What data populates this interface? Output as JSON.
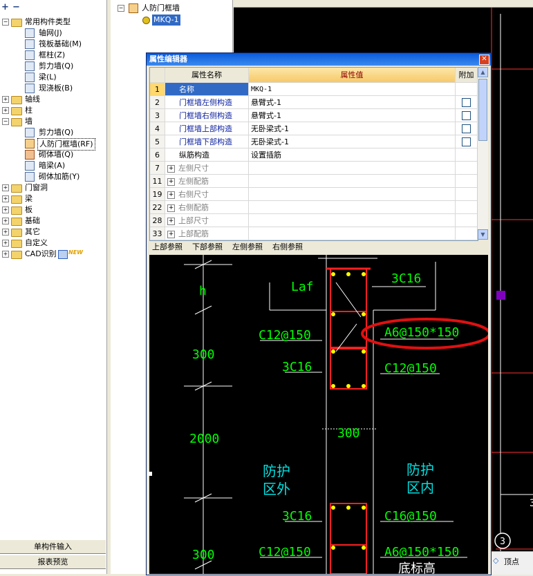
{
  "left_tree": {
    "root": "常用构件类型",
    "root_children": [
      "轴网(J)",
      "筏板基础(M)",
      "框柱(Z)",
      "剪力墙(Q)",
      "梁(L)",
      "现浇板(B)"
    ],
    "group_axis": "轴线",
    "group_col": "柱",
    "group_wall": "墙",
    "wall_children": [
      "剪力墙(Q)",
      "人防门框墙(RF)",
      "砌体墙(Q)",
      "暗梁(A)",
      "砌体加筋(Y)"
    ],
    "groups_after": [
      "门窗洞",
      "梁",
      "板",
      "基础",
      "其它",
      "自定义",
      "CAD识别"
    ],
    "new_badge": "NEW",
    "bottom_buttons": [
      "单构件输入",
      "报表预览"
    ]
  },
  "mid_tree": {
    "parent": "人防门框墙",
    "child": "MKQ-1"
  },
  "dialog": {
    "title": "属性编辑器",
    "close_glyph": "✕",
    "headers": {
      "name": "属性名称",
      "value": "属性值",
      "extra": "附加"
    },
    "rows": [
      {
        "num": "1",
        "name": "名称",
        "value": "MKQ-1"
      },
      {
        "num": "2",
        "name": "门框墙左侧构造",
        "value": "悬臂式-1"
      },
      {
        "num": "3",
        "name": "门框墙右侧构造",
        "value": "悬臂式-1"
      },
      {
        "num": "4",
        "name": "门框墙上部构造",
        "value": "无卧梁式-1"
      },
      {
        "num": "5",
        "name": "门框墙下部构造",
        "value": "无卧梁式-1"
      },
      {
        "num": "6",
        "name": "纵筋构造",
        "value": "设置插筋"
      },
      {
        "num": "7",
        "name": "左侧尺寸",
        "value": ""
      },
      {
        "num": "11",
        "name": "左侧配筋",
        "value": ""
      },
      {
        "num": "19",
        "name": "右侧尺寸",
        "value": ""
      },
      {
        "num": "22",
        "name": "右侧配筋",
        "value": ""
      },
      {
        "num": "28",
        "name": "上部尺寸",
        "value": ""
      },
      {
        "num": "33",
        "name": "上部配筋",
        "value": ""
      }
    ],
    "tabs": [
      "上部参照",
      "下部参照",
      "左侧参照",
      "右侧参照"
    ]
  },
  "drawing": {
    "labels": {
      "h": "h",
      "laf": "Laf",
      "top_bars": "3C16",
      "c12_1": "C12@150",
      "a6_1": "A6@150*150",
      "mid_bars": "3C16",
      "c12_2": "C12@150",
      "dim300_1": "300",
      "dim2000": "2000",
      "dim300_wall": "300",
      "outside_1": "防护",
      "outside_2": "区外",
      "inside_1": "防护",
      "inside_2": "区内",
      "low_bars": "3C16",
      "c16": "C16@150",
      "dim300_2": "300",
      "c12_3": "C12@150",
      "a6_2": "A6@150*150",
      "bottom_elev": "底标高"
    }
  },
  "cad": {
    "axis_bubble": "3",
    "vertex_label": "顶点",
    "edge_digit": "3"
  },
  "colors": {
    "accent_red": "#e01010",
    "dim_green": "#00ff00",
    "label_cyan": "#00e0e0",
    "rebar_red": "#ff2020",
    "rebar_dot": "#ffff00",
    "cad_magenta": "#8000c0"
  }
}
